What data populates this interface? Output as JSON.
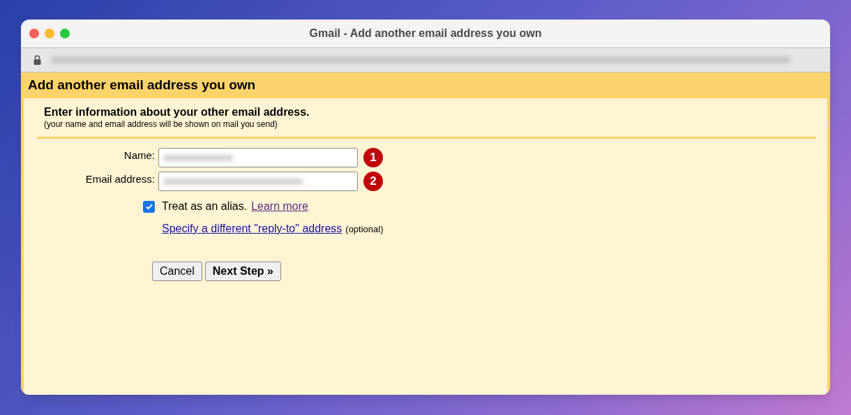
{
  "window": {
    "title": "Gmail - Add another email address you own"
  },
  "page": {
    "heading": "Add another email address you own",
    "intro": "Enter information about your other email address.",
    "note": "(your name and email address will be shown on mail you send)"
  },
  "fields": [
    {
      "label": "Name:",
      "callout": "1"
    },
    {
      "label": "Email address:",
      "callout": "2"
    }
  ],
  "alias": {
    "checked": true,
    "label": "Treat as an alias.",
    "link": "Learn more"
  },
  "reply_to": {
    "link": "Specify a different \"reply-to\" address",
    "note": "(optional)"
  },
  "buttons": [
    {
      "label": "Cancel",
      "kind": "default"
    },
    {
      "label": "Next Step »",
      "kind": "primary"
    }
  ]
}
